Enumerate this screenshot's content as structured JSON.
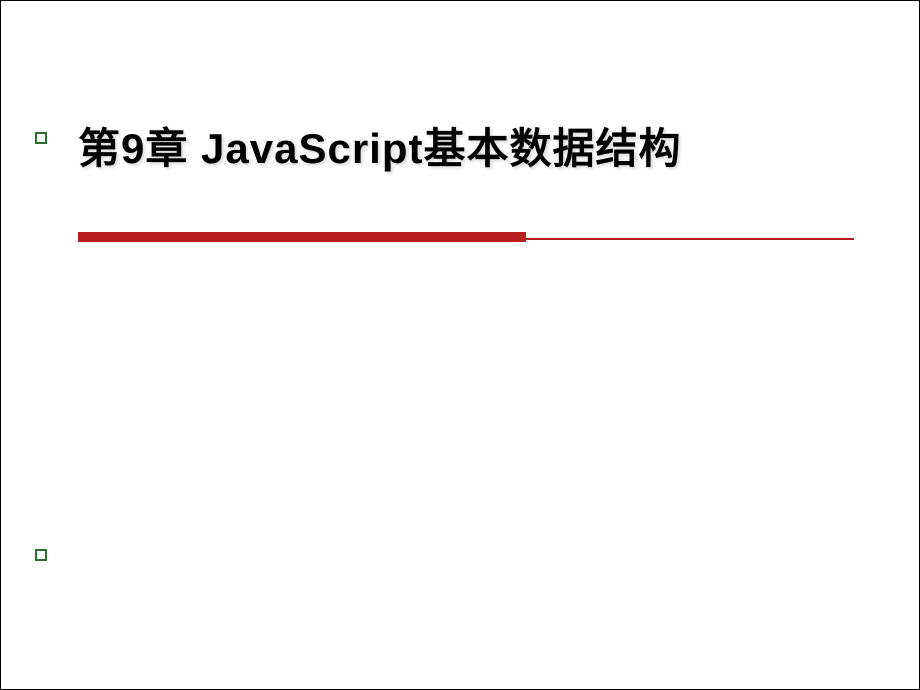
{
  "slide": {
    "title": "第9章 JavaScript基本数据结构"
  },
  "colors": {
    "accent_red": "#b91e1e",
    "accent_green": "#2c6e2e"
  }
}
